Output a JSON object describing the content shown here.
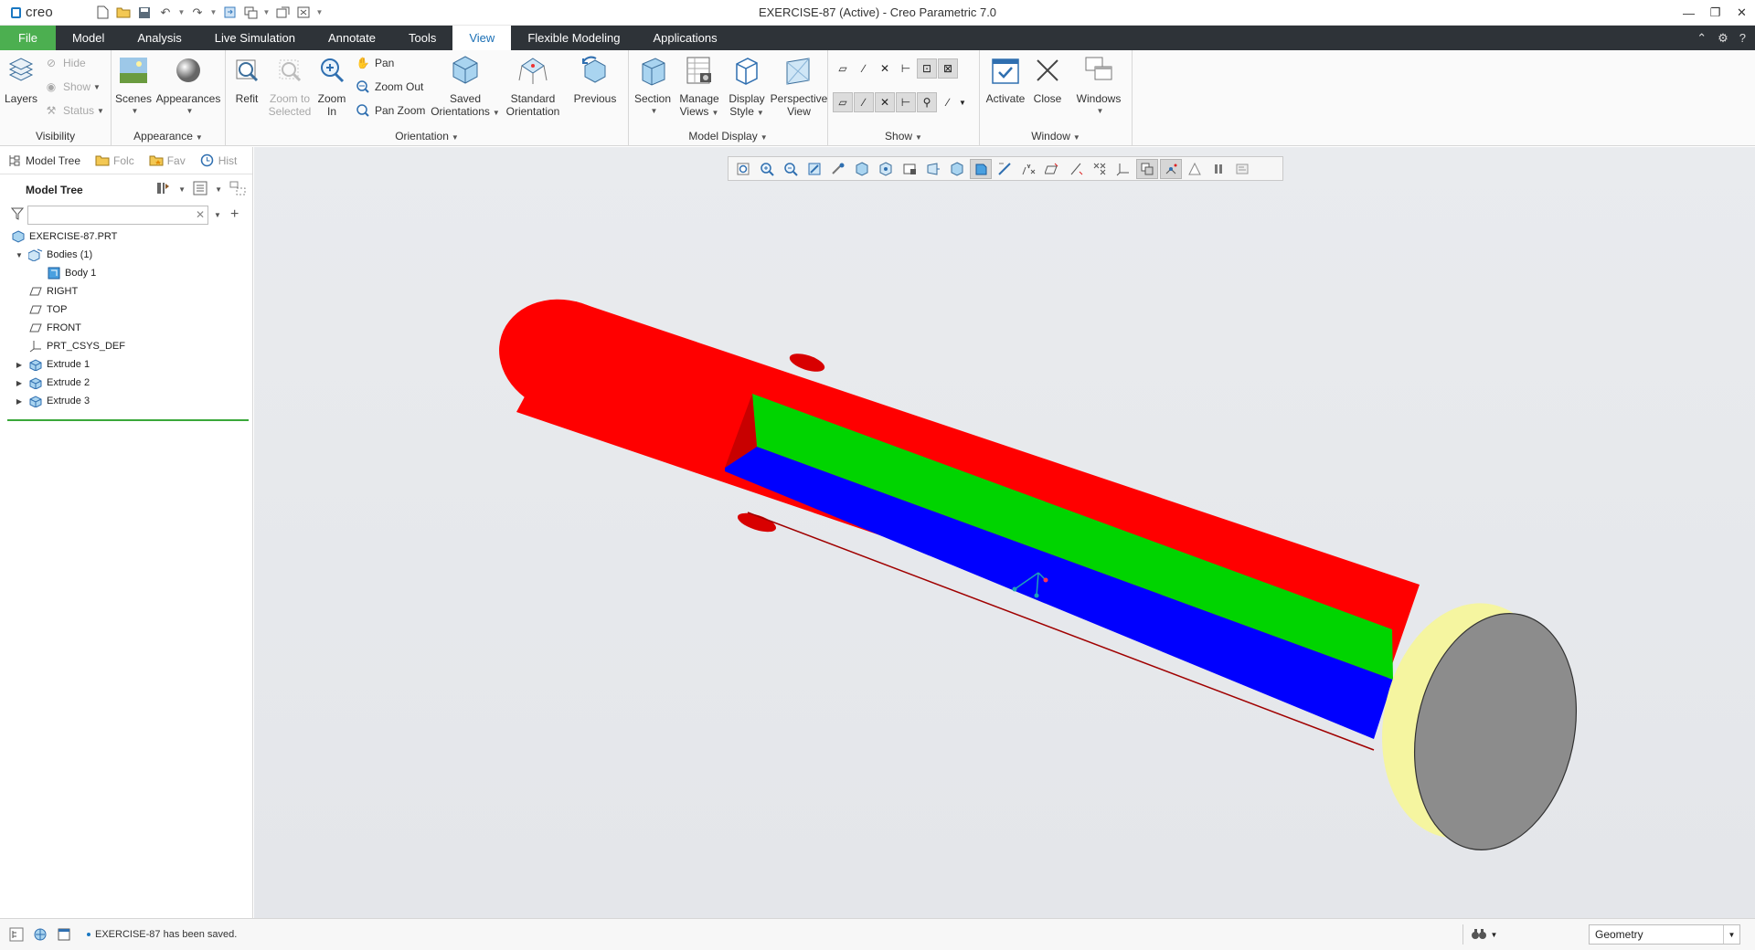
{
  "window": {
    "brand": "creo",
    "title": "EXERCISE-87 (Active) - Creo Parametric 7.0"
  },
  "menu": {
    "tabs": [
      "File",
      "Model",
      "Analysis",
      "Live Simulation",
      "Annotate",
      "Tools",
      "View",
      "Flexible Modeling",
      "Applications"
    ],
    "active": "View"
  },
  "ribbon": {
    "visibility": {
      "label": "Visibility",
      "layers": "Layers",
      "hide": "Hide",
      "show": "Show",
      "status": "Status"
    },
    "appearance": {
      "label": "Appearance",
      "scenes": "Scenes",
      "appearances": "Appearances"
    },
    "orientation": {
      "label": "Orientation",
      "refit": "Refit",
      "zoom_to_selected_1": "Zoom to",
      "zoom_to_selected_2": "Selected",
      "zoom_in_1": "Zoom",
      "zoom_in_2": "In",
      "pan": "Pan",
      "zoom_out": "Zoom Out",
      "pan_zoom": "Pan Zoom",
      "saved_1": "Saved",
      "saved_2": "Orientations",
      "standard_1": "Standard",
      "standard_2": "Orientation",
      "previous": "Previous"
    },
    "model_display": {
      "label": "Model Display",
      "section": "Section",
      "manage_1": "Manage",
      "manage_2": "Views",
      "display_1": "Display",
      "display_2": "Style",
      "perspective_1": "Perspective",
      "perspective_2": "View"
    },
    "show": {
      "label": "Show"
    },
    "window": {
      "label": "Window",
      "activate": "Activate",
      "close": "Close",
      "windows": "Windows"
    }
  },
  "left_panel": {
    "tabs": [
      "Model Tree",
      "Folc",
      "Fav",
      "Hist"
    ],
    "tree_title": "Model Tree",
    "filter_value": "",
    "tree": [
      {
        "label": "EXERCISE-87.PRT",
        "icon": "part-icon",
        "indent": 0,
        "expander": ""
      },
      {
        "label": "Bodies (1)",
        "icon": "bodies-icon",
        "indent": 1,
        "expander": "▼"
      },
      {
        "label": "Body 1",
        "icon": "body-icon",
        "indent": 2,
        "expander": ""
      },
      {
        "label": "RIGHT",
        "icon": "datum-plane-icon",
        "indent": 1,
        "expander": ""
      },
      {
        "label": "TOP",
        "icon": "datum-plane-icon",
        "indent": 1,
        "expander": ""
      },
      {
        "label": "FRONT",
        "icon": "datum-plane-icon",
        "indent": 1,
        "expander": ""
      },
      {
        "label": "PRT_CSYS_DEF",
        "icon": "csys-icon",
        "indent": 1,
        "expander": ""
      },
      {
        "label": "Extrude 1",
        "icon": "extrude-icon",
        "indent": 1,
        "expander": "▶"
      },
      {
        "label": "Extrude 2",
        "icon": "extrude-icon",
        "indent": 1,
        "expander": "▶"
      },
      {
        "label": "Extrude 3",
        "icon": "extrude-icon",
        "indent": 1,
        "expander": "▶"
      }
    ]
  },
  "model_colors": {
    "shaft": "#ff0000",
    "slot_top": "#00d400",
    "slot_bottom": "#0000ff",
    "flange_rim": "#f5f5a0",
    "flange_face": "#8c8c8c"
  },
  "status_bar": {
    "message": "EXERCISE-87 has been saved.",
    "filter": "Geometry"
  }
}
